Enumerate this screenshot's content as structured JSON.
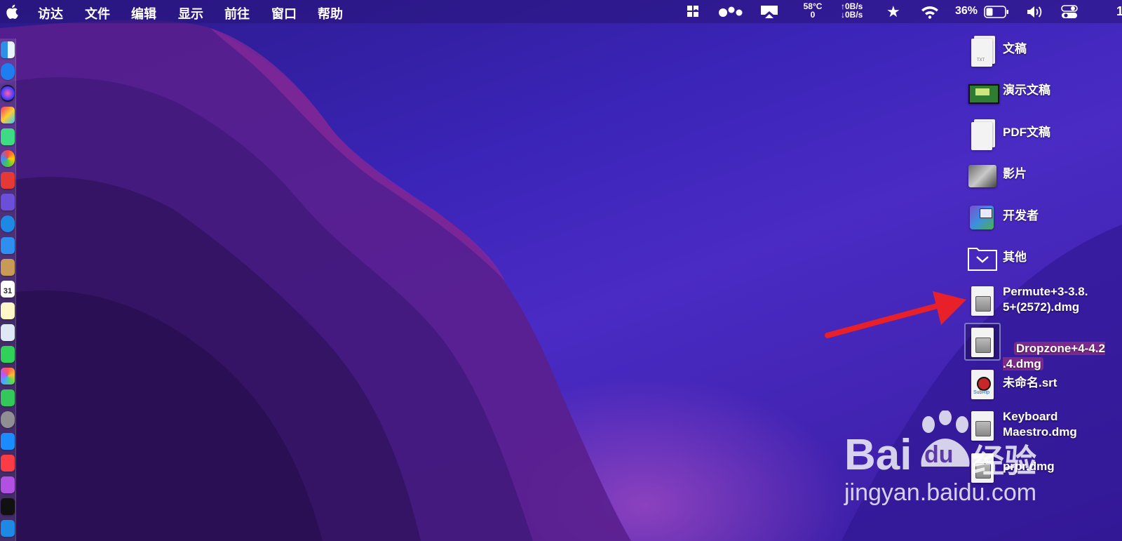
{
  "menubar": {
    "app": "访达",
    "items": [
      "文件",
      "编辑",
      "显示",
      "前往",
      "窗口",
      "帮助"
    ],
    "status": {
      "temp": "58°C",
      "temp_sub": "0",
      "net_up": "↑0B/s",
      "net_down": "↓0B/s",
      "battery": "36%",
      "extra": "1"
    }
  },
  "desktop": {
    "items": [
      {
        "label": "文稿",
        "icon": "text-document-icon"
      },
      {
        "label": "演示文稿",
        "icon": "presentation-icon"
      },
      {
        "label": "PDF文稿",
        "icon": "pdf-document-icon"
      },
      {
        "label": "影片",
        "icon": "movie-icon"
      },
      {
        "label": "开发者",
        "icon": "developer-icon"
      },
      {
        "label": "其他",
        "icon": "folder-expand-icon"
      },
      {
        "label": "Permute+3-3.8.\n5+(2572).dmg",
        "icon": "dmg-disk-image-icon"
      },
      {
        "label": "Dropzone+4-4.2\n.4.dmg",
        "icon": "dmg-disk-image-icon",
        "selected": true
      },
      {
        "label": "未命名.srt",
        "icon": "subrip-file-icon"
      },
      {
        "label": "Keyboard\nMaestro.dmg",
        "icon": "dmg-disk-image-icon"
      },
      {
        "label": "prpr.dmg",
        "icon": "dmg-disk-image-icon"
      }
    ]
  },
  "watermark": {
    "brand": "Bai",
    "brand_mid": "du",
    "brand_cn": "经验",
    "url": "jingyan.baidu.com"
  },
  "colors": {
    "arrow": "#e8202a",
    "selection": "#7a2a8a"
  }
}
